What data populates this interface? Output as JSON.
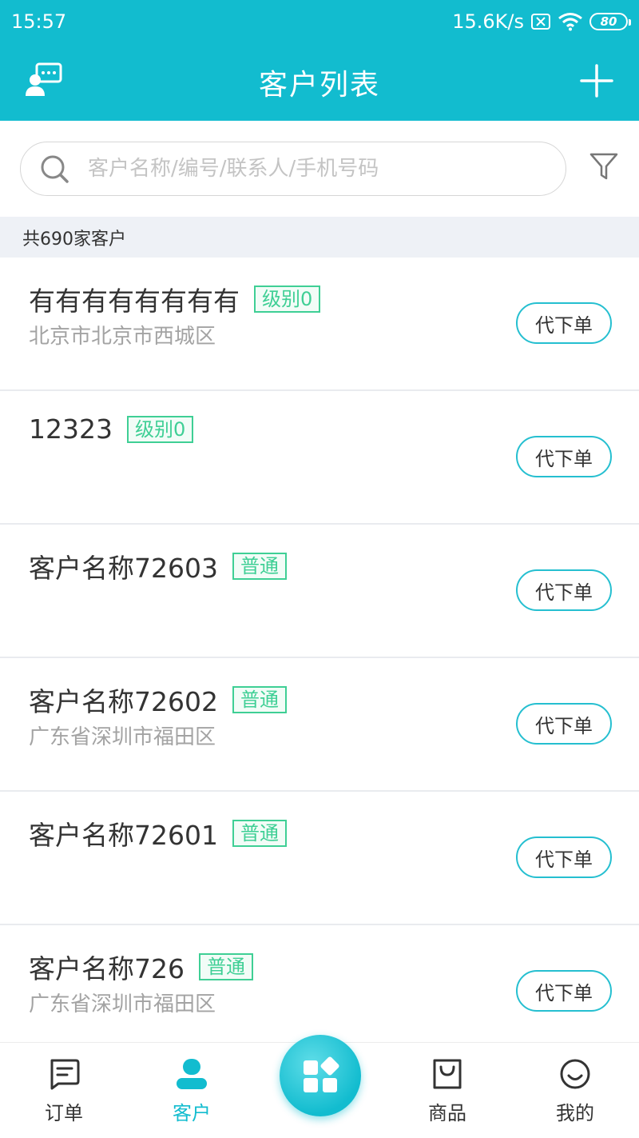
{
  "status_bar": {
    "time": "15:57",
    "network_speed": "15.6K/s",
    "battery": "80"
  },
  "header": {
    "title": "客户列表",
    "left_icon": "chat-users-icon",
    "right_icon": "plus-icon"
  },
  "search": {
    "placeholder": "客户名称/编号/联系人/手机号码",
    "filter_icon": "filter-icon"
  },
  "count_text": "共690家客户",
  "customers": [
    {
      "name": "有有有有有有有有",
      "tag": "级别0",
      "address": "北京市北京市西城区",
      "button": "代下单"
    },
    {
      "name": "12323",
      "tag": "级别0",
      "address": "",
      "button": "代下单"
    },
    {
      "name": "客户名称72603",
      "tag": "普通",
      "address": "",
      "button": "代下单"
    },
    {
      "name": "客户名称72602",
      "tag": "普通",
      "address": "广东省深圳市福田区",
      "button": "代下单"
    },
    {
      "name": "客户名称72601",
      "tag": "普通",
      "address": "",
      "button": "代下单"
    },
    {
      "name": "客户名称726",
      "tag": "普通",
      "address": "广东省深圳市福田区",
      "button": "代下单"
    }
  ],
  "tabs": [
    {
      "label": "订单",
      "icon": "order-icon",
      "active": false
    },
    {
      "label": "客户",
      "icon": "customer-icon",
      "active": true
    },
    {
      "label": "商品",
      "icon": "bag-icon",
      "active": false
    },
    {
      "label": "我的",
      "icon": "smile-icon",
      "active": false
    }
  ],
  "center_button_icon": "apps-icon",
  "colors": {
    "primary": "#12bccf",
    "tag_green": "#3fcf95",
    "count_bar_bg": "#eef1f6"
  }
}
